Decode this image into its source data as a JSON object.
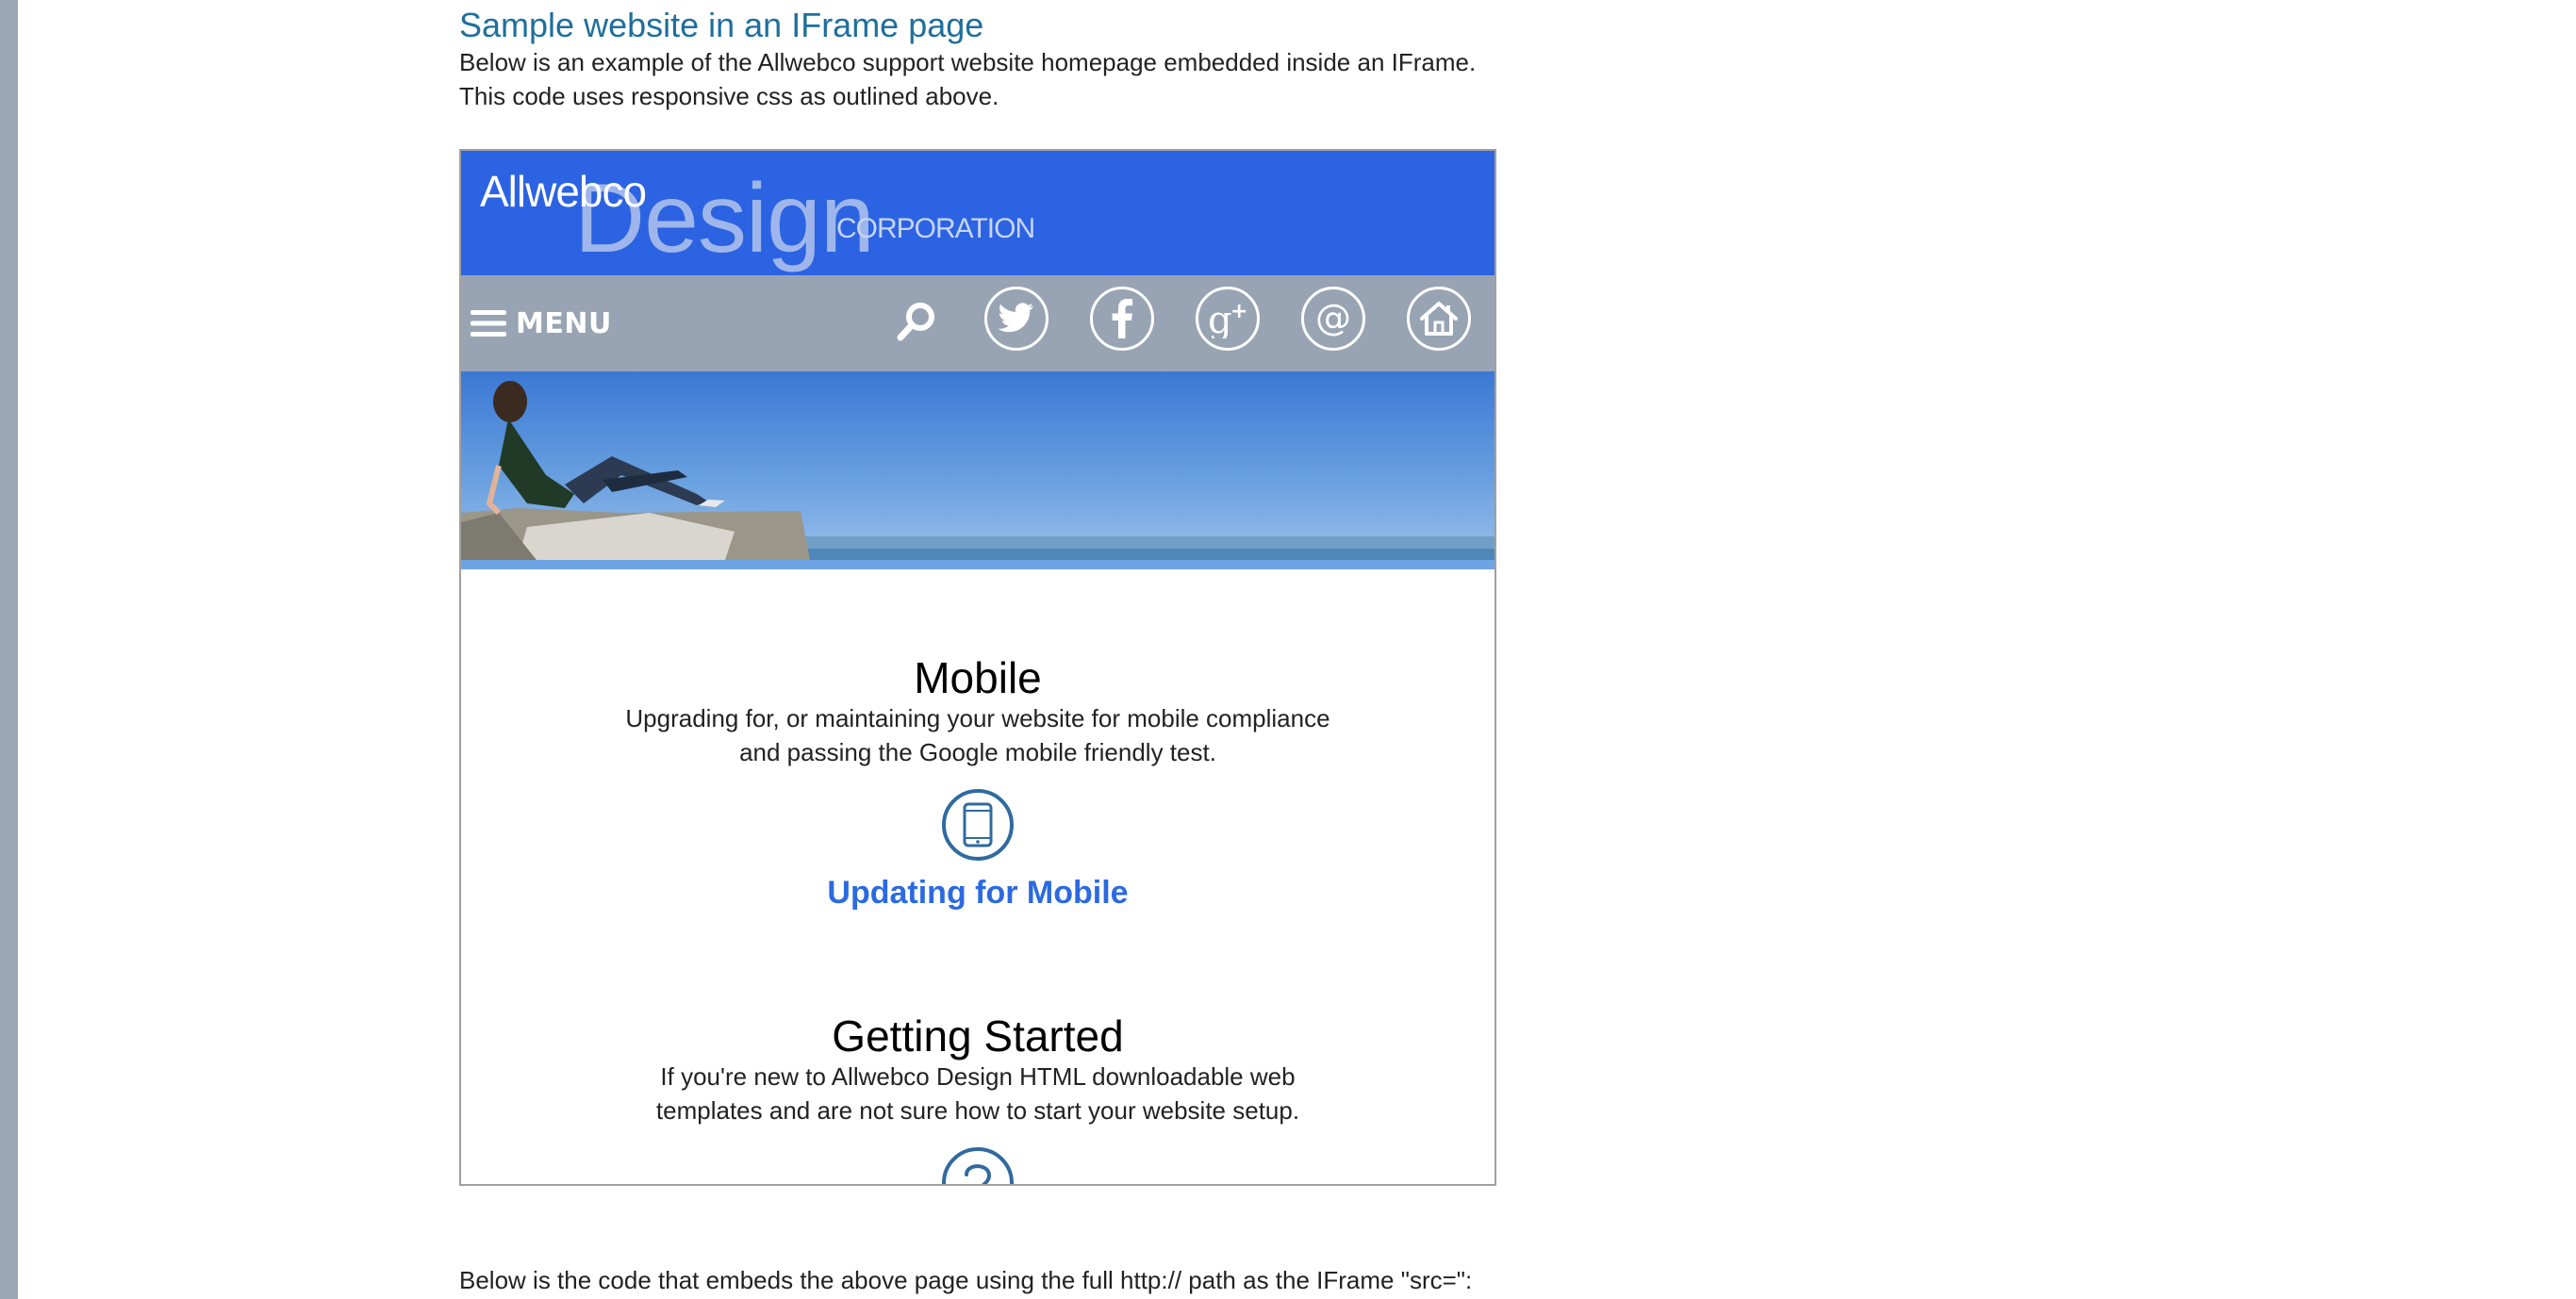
{
  "page": {
    "section_heading": "Sample website in an IFrame page",
    "intro_line1": "Below is an example of the Allwebco support website homepage embedded inside an IFrame.",
    "intro_line2": "This code uses responsive css as outlined above.",
    "bottom_text": "Below is the code that embeds the above page using the full http:// path as the IFrame \"src=\":"
  },
  "iframe_site": {
    "logo": {
      "allwebco": "Allwebco",
      "design": "Design",
      "corporation": "CORPORATION"
    },
    "nav": {
      "menu_label": "MENU",
      "icons": [
        "search-icon",
        "twitter-icon",
        "facebook-icon",
        "google-plus-icon",
        "email-at-icon",
        "home-icon"
      ]
    },
    "sections": [
      {
        "title": "Mobile",
        "desc_line1": "Upgrading for, or maintaining your website for mobile compliance",
        "desc_line2": "and passing the Google mobile friendly test.",
        "icon": "mobile-phone-icon",
        "link": "Updating for Mobile"
      },
      {
        "title": "Getting Started",
        "desc_line1": "If you're new to Allwebco Design HTML downloadable web",
        "desc_line2": "templates and are not sure how to start your website setup.",
        "icon": "question-mark-icon"
      }
    ]
  },
  "colors": {
    "heading": "#1f6f9c",
    "header_blue": "#2b63e2",
    "nav_gray": "#98a4b3",
    "link_blue": "#2b6ae0",
    "icon_circle": "#2f6aa0"
  }
}
